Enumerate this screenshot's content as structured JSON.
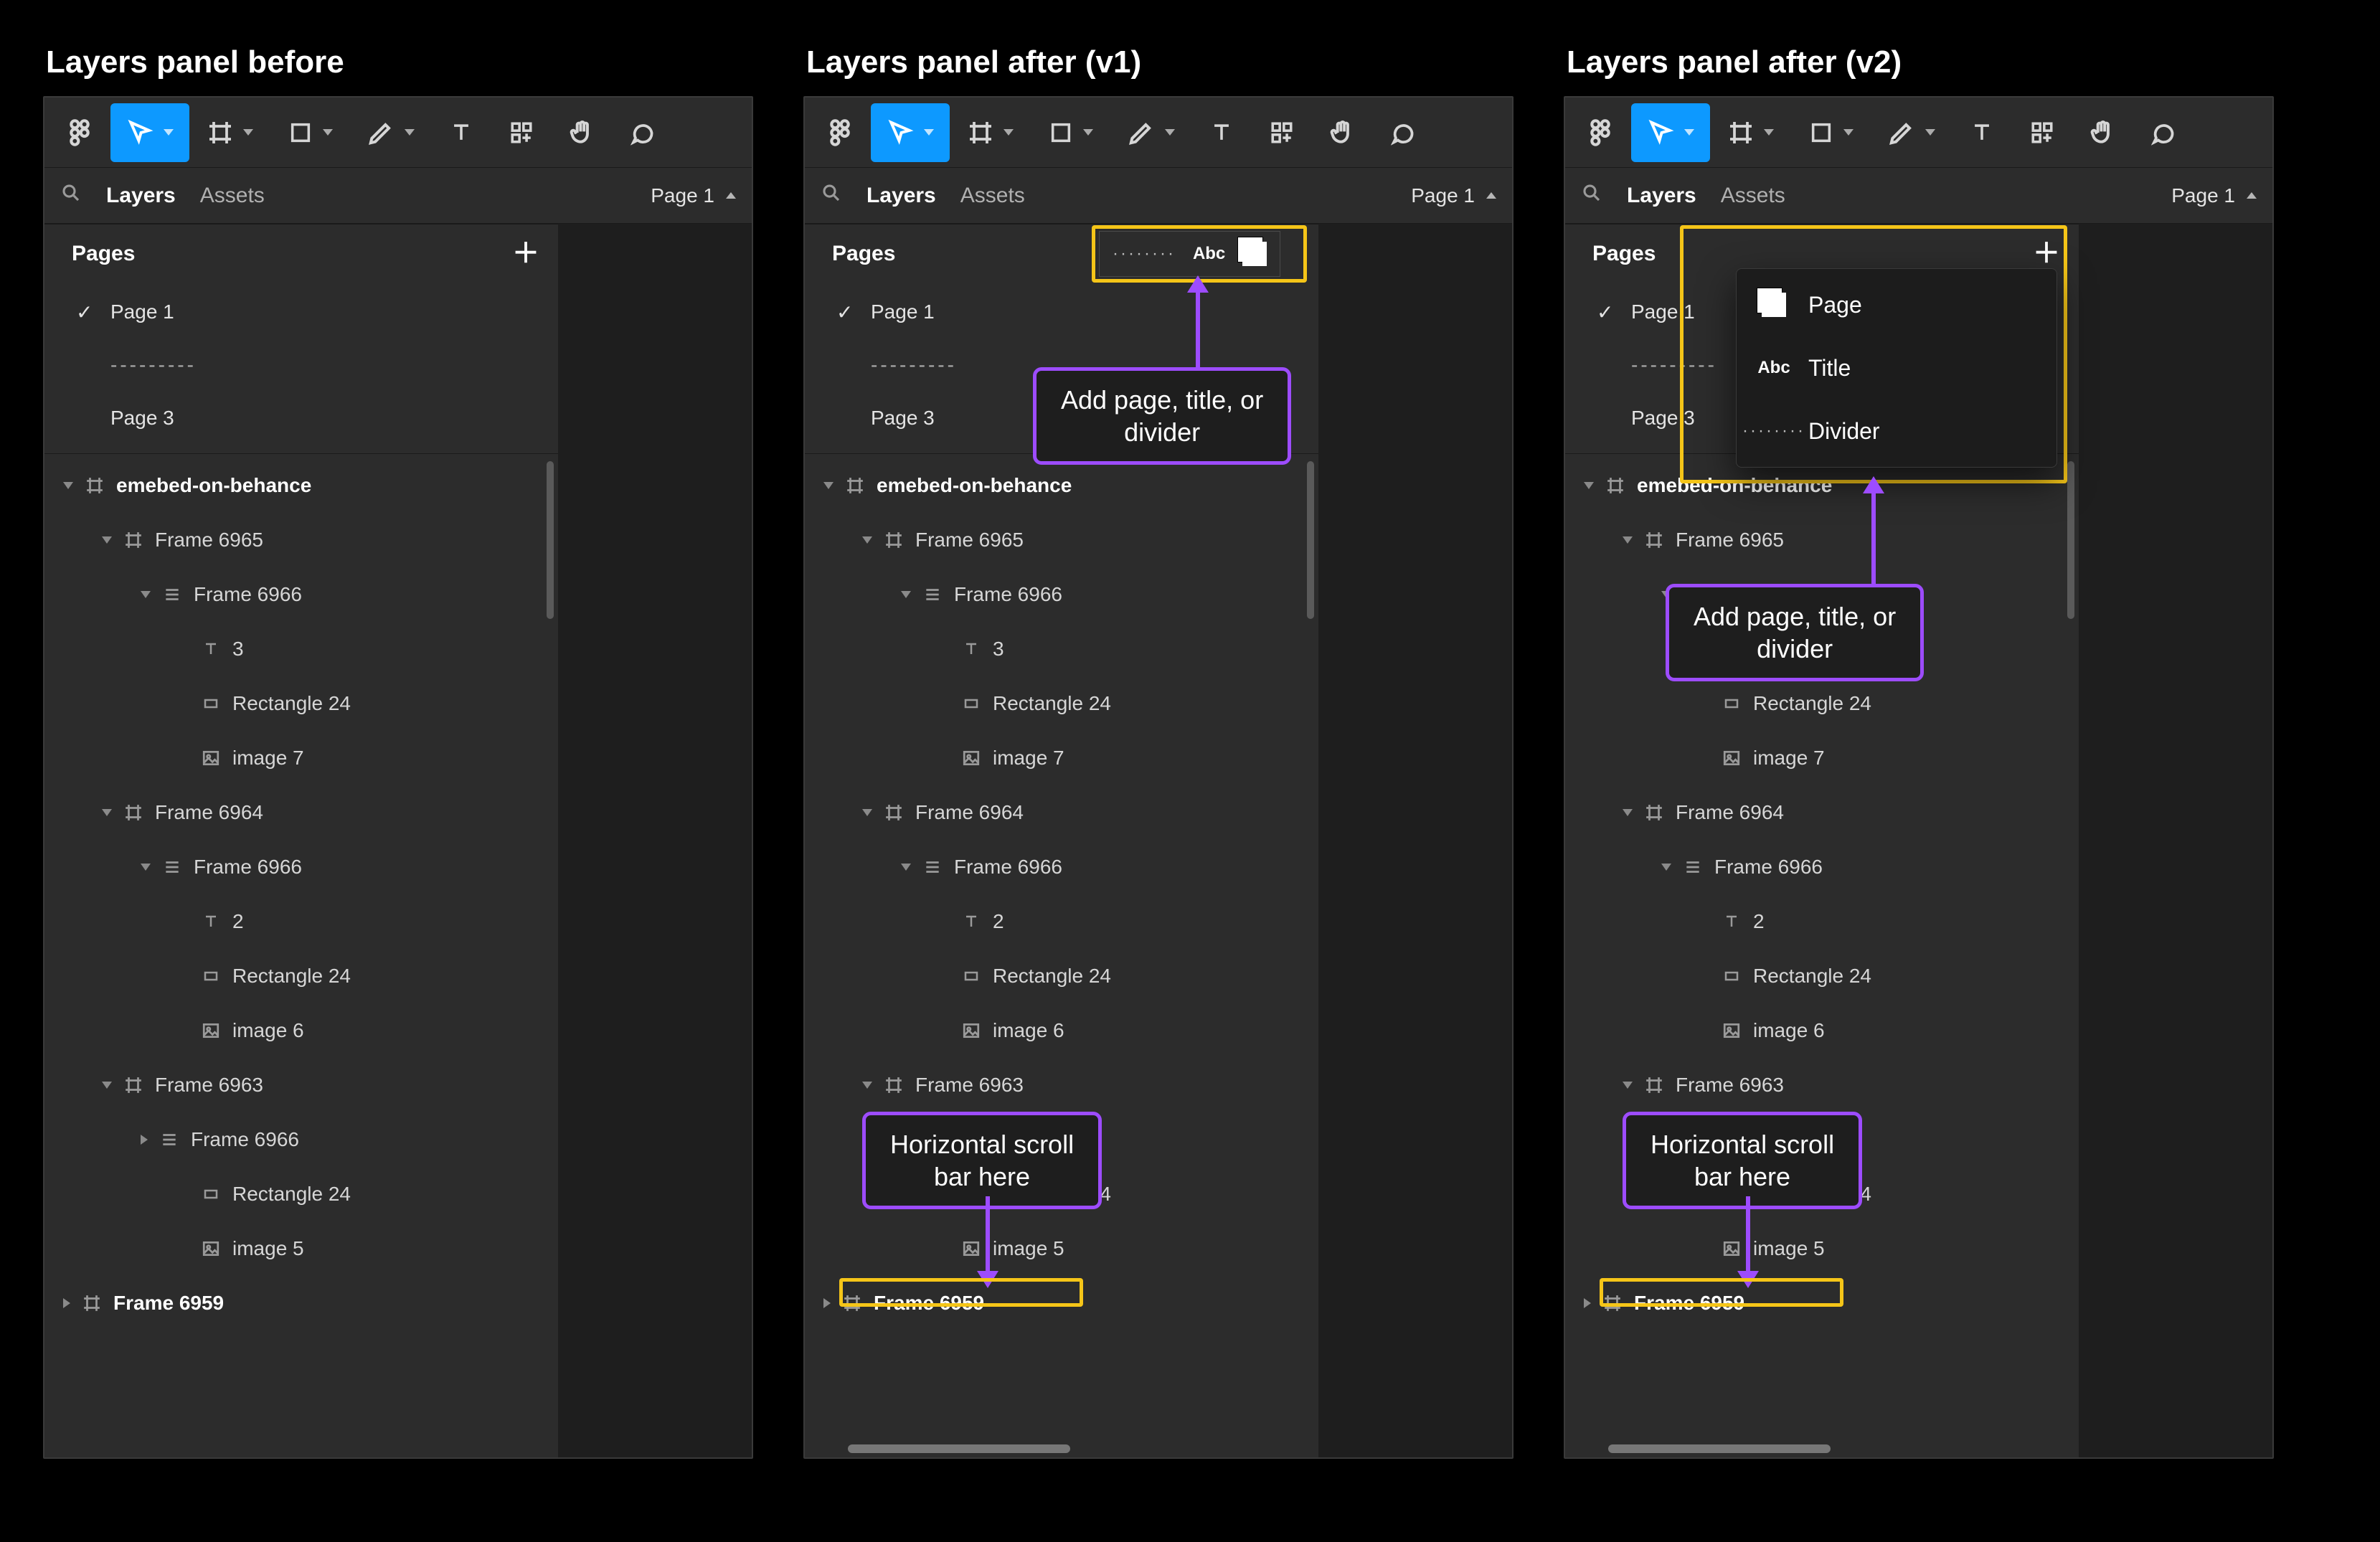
{
  "columns": [
    {
      "title": "Layers panel before"
    },
    {
      "title": "Layers panel after (v1)"
    },
    {
      "title": "Layers panel after (v2)"
    }
  ],
  "tabs": {
    "layers": "Layers",
    "assets": "Assets",
    "pagePicker": "Page 1"
  },
  "pagesHeader": "Pages",
  "pages": [
    {
      "label": "Page 1",
      "checked": true
    },
    {
      "label": "---------",
      "divider": true
    },
    {
      "label": "Page 3"
    }
  ],
  "tree": [
    {
      "d": 0,
      "icon": "frame",
      "label": "emebed-on-behance",
      "bold": true,
      "caret": "down"
    },
    {
      "d": 1,
      "icon": "frame",
      "label": "Frame 6965",
      "caret": "down"
    },
    {
      "d": 2,
      "icon": "stack",
      "label": "Frame 6966",
      "caret": "down"
    },
    {
      "d": 3,
      "icon": "text",
      "label": "3"
    },
    {
      "d": 3,
      "icon": "rect",
      "label": "Rectangle 24"
    },
    {
      "d": 3,
      "icon": "image",
      "label": "image 7"
    },
    {
      "d": 1,
      "icon": "frame",
      "label": "Frame 6964",
      "caret": "down"
    },
    {
      "d": 2,
      "icon": "stack",
      "label": "Frame 6966",
      "caret": "down"
    },
    {
      "d": 3,
      "icon": "text",
      "label": "2"
    },
    {
      "d": 3,
      "icon": "rect",
      "label": "Rectangle 24"
    },
    {
      "d": 3,
      "icon": "image",
      "label": "image 6"
    },
    {
      "d": 1,
      "icon": "frame",
      "label": "Frame 6963",
      "caret": "down"
    },
    {
      "d": 2,
      "icon": "stack",
      "label": "Frame 6966",
      "caret": "right"
    },
    {
      "d": 3,
      "icon": "rect",
      "label": "Rectangle 24"
    },
    {
      "d": 3,
      "icon": "image",
      "label": "image 5"
    },
    {
      "d": 0,
      "icon": "frame",
      "label": "Frame 6959",
      "bold": true,
      "caret": "right"
    }
  ],
  "pill": {
    "abc": "Abc"
  },
  "menu": [
    {
      "icon": "page",
      "label": "Page"
    },
    {
      "icon": "abc",
      "label": "Title"
    },
    {
      "icon": "dots",
      "label": "Divider"
    }
  ],
  "annotations": {
    "addPage": "Add page, title, or\ndivider",
    "hscroll": "Horizontal scroll\nbar here"
  }
}
